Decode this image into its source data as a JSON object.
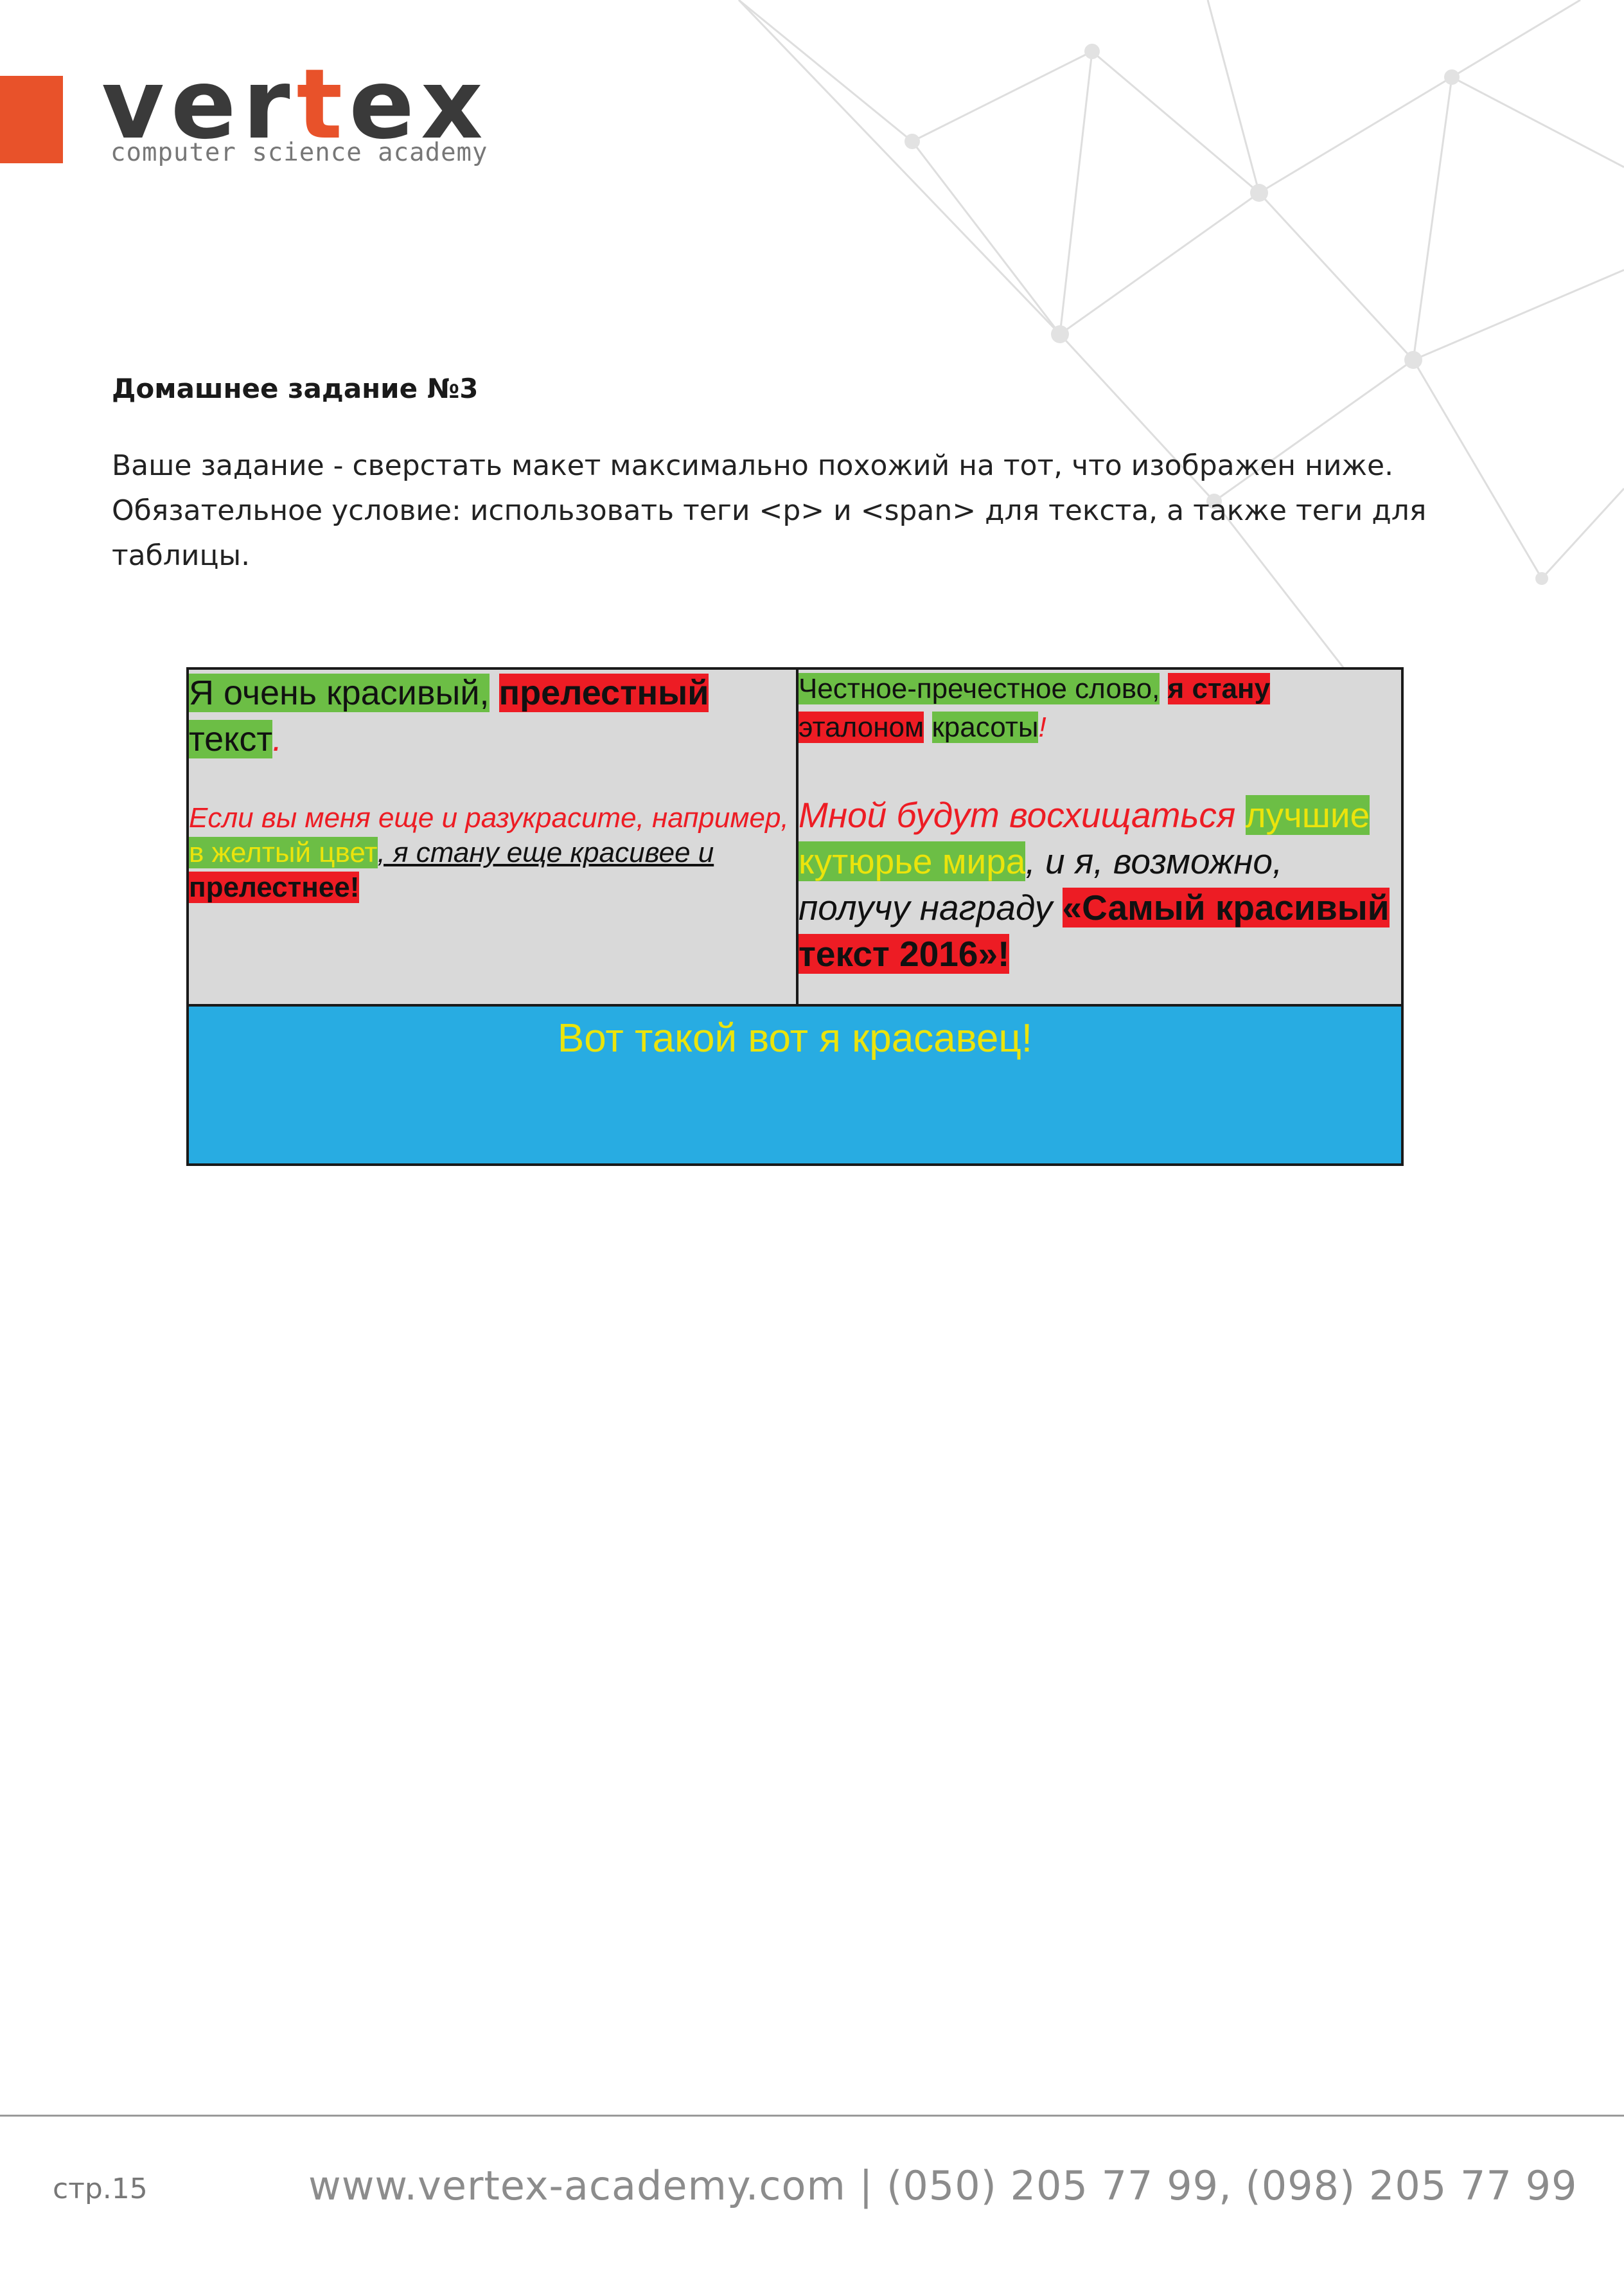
{
  "brand": {
    "name_pre": "ver",
    "name_accent": "t",
    "name_post": "ex",
    "tagline": "computer science academy",
    "accent_color": "#e8522a"
  },
  "assignment": {
    "title": "Домашнее задание №3",
    "lines": [
      "Ваше задание - сверстать макет максимально похожий на тот, что изображен ниже.",
      "Обязательное условие:  использовать теги <p>  и  <span>  для текста,  а также теги для",
      "таблицы."
    ]
  },
  "table": {
    "cell_a": {
      "p1": {
        "s1": "Я очень красивый,",
        "s2": "прелестный",
        "s3": "текст",
        "s4": "."
      },
      "p2": {
        "s1": "Если вы меня еще и разукрасите,  например,",
        "s2": "в желтый цвет",
        "s3": ", я стану еще красивее и",
        "s4": "прелестнее!"
      }
    },
    "cell_b": {
      "p1": {
        "s1": "Честное-пречестное слово,",
        "s2": "я стану",
        "s3": "эталоном",
        "s4": "красоты",
        "s5": "!"
      },
      "p2": {
        "s1": "Мной будут восхищаться",
        "s2": "лучшие кутюрье мира",
        "s3": ", и я, возможно, получу награду",
        "s4": "«Самый красивый текст 2016»!"
      }
    },
    "cell_c": {
      "text": "Вот такой вот я красавец!"
    },
    "colors": {
      "green": "#6cbe45",
      "red": "#ed1c24",
      "yellow": "#ebe40c",
      "grey": "#d9d9d9",
      "blue": "#28ace2"
    }
  },
  "footer": {
    "page": "стр.15",
    "contact": "www.vertex-academy.com  |  (050) 205 77 99, (098) 205 77 99"
  }
}
